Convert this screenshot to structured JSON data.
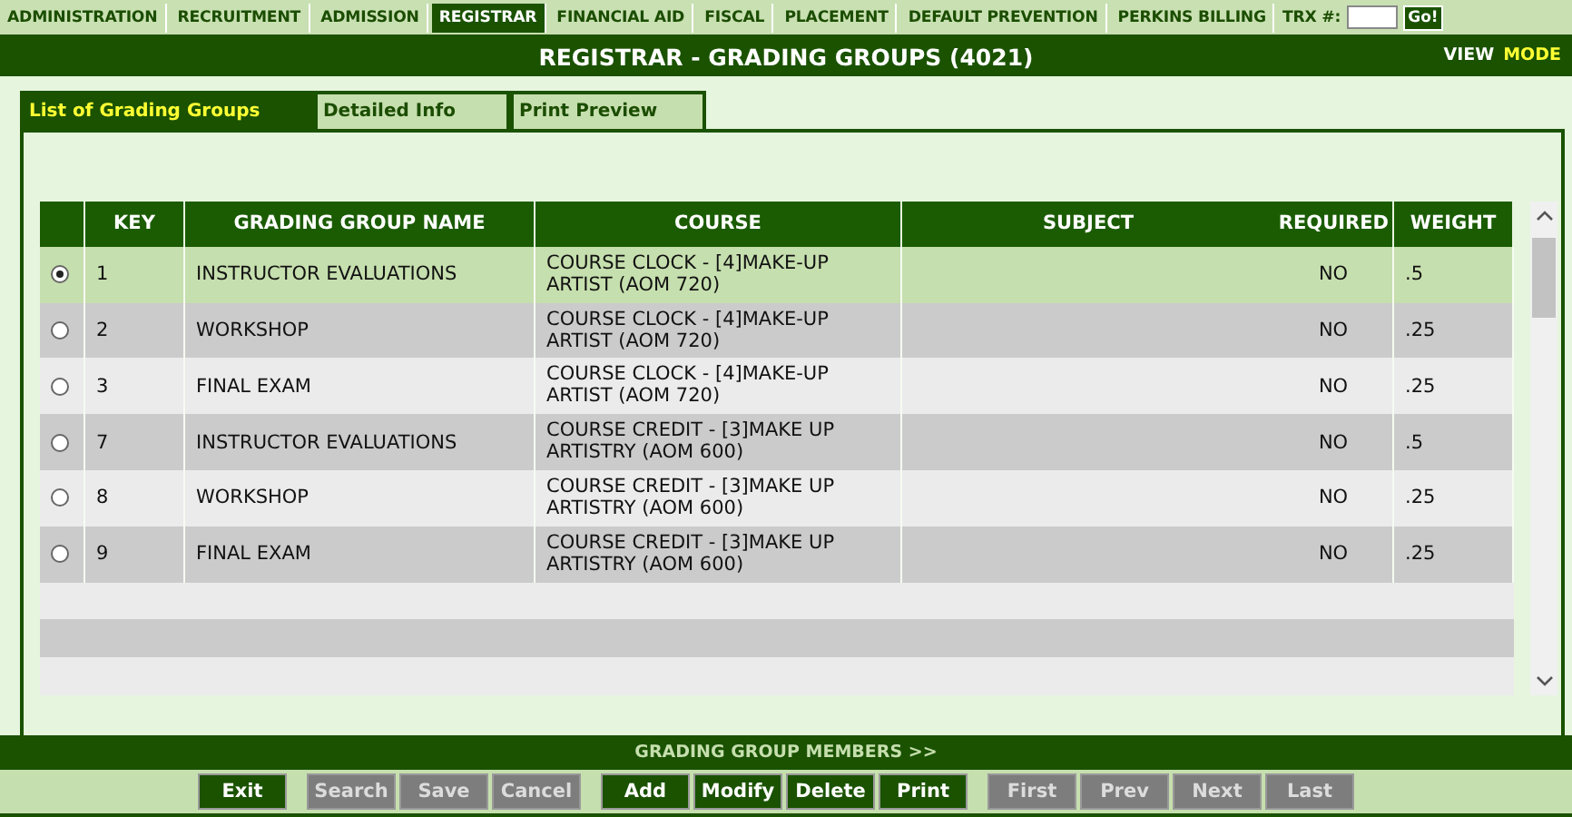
{
  "nav": {
    "items": [
      {
        "label": "ADMINISTRATION",
        "selected": false
      },
      {
        "label": "RECRUITMENT",
        "selected": false
      },
      {
        "label": "ADMISSION",
        "selected": false
      },
      {
        "label": "REGISTRAR",
        "selected": true
      },
      {
        "label": "FINANCIAL AID",
        "selected": false
      },
      {
        "label": "FISCAL",
        "selected": false
      },
      {
        "label": "PLACEMENT",
        "selected": false
      },
      {
        "label": "DEFAULT PREVENTION",
        "selected": false
      },
      {
        "label": "PERKINS BILLING",
        "selected": false
      }
    ],
    "trx_label": "TRX #:",
    "go_button": "Go!"
  },
  "title_bar": {
    "title": "REGISTRAR - GRADING GROUPS (4021)",
    "view": "VIEW",
    "mode": "MODE"
  },
  "tabs": [
    {
      "label": "List of Grading Groups",
      "selected": true
    },
    {
      "label": "Detailed Info",
      "selected": false
    },
    {
      "label": "Print Preview",
      "selected": false
    }
  ],
  "table": {
    "columns": [
      "KEY",
      "GRADING GROUP NAME",
      "COURSE",
      "SUBJECT",
      "REQUIRED",
      "WEIGHT"
    ],
    "rows": [
      {
        "selected": true,
        "key": "1",
        "name": "INSTRUCTOR EVALUATIONS",
        "course": "COURSE CLOCK - [4]MAKE-UP ARTIST (AOM 720)",
        "required": "NO",
        "weight": ".5"
      },
      {
        "selected": false,
        "key": "2",
        "name": "WORKSHOP",
        "course": "COURSE CLOCK - [4]MAKE-UP ARTIST (AOM 720)",
        "required": "NO",
        "weight": ".25"
      },
      {
        "selected": false,
        "key": "3",
        "name": "FINAL EXAM",
        "course": "COURSE CLOCK - [4]MAKE-UP ARTIST (AOM 720)",
        "required": "NO",
        "weight": ".25"
      },
      {
        "selected": false,
        "key": "7",
        "name": "INSTRUCTOR EVALUATIONS",
        "course": "COURSE CREDIT - [3]MAKE UP ARTISTRY (AOM 600)",
        "required": "NO",
        "weight": ".5"
      },
      {
        "selected": false,
        "key": "8",
        "name": "WORKSHOP",
        "course": "COURSE CREDIT - [3]MAKE UP ARTISTRY (AOM 600)",
        "required": "NO",
        "weight": ".25"
      },
      {
        "selected": false,
        "key": "9",
        "name": "FINAL EXAM",
        "course": "COURSE CREDIT - [3]MAKE UP ARTISTRY (AOM 600)",
        "required": "NO",
        "weight": ".25"
      }
    ]
  },
  "members_bar": "GRADING GROUP MEMBERS >>",
  "buttons": [
    {
      "label": "Exit",
      "disabled": false
    },
    {
      "label": "Search",
      "disabled": true
    },
    {
      "label": "Save",
      "disabled": true
    },
    {
      "label": "Cancel",
      "disabled": true
    },
    {
      "label": "Add",
      "disabled": false
    },
    {
      "label": "Modify",
      "disabled": false
    },
    {
      "label": "Delete",
      "disabled": false
    },
    {
      "label": "Print",
      "disabled": false
    },
    {
      "label": "First",
      "disabled": true
    },
    {
      "label": "Prev",
      "disabled": true
    },
    {
      "label": "Next",
      "disabled": true
    },
    {
      "label": "Last",
      "disabled": true
    }
  ]
}
